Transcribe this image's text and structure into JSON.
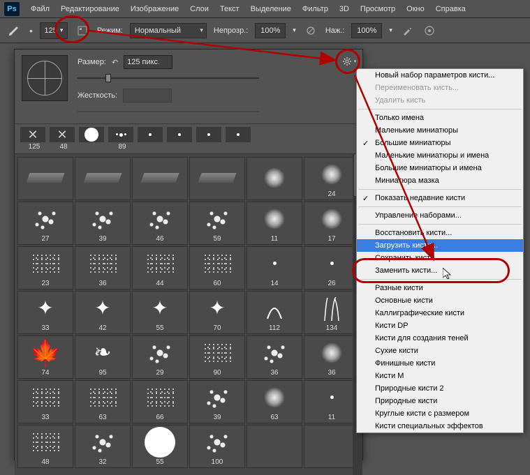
{
  "app": {
    "logo": "Ps"
  },
  "menu": [
    "Файл",
    "Редактирование",
    "Изображение",
    "Слои",
    "Текст",
    "Выделение",
    "Фильтр",
    "3D",
    "Просмотр",
    "Окно",
    "Справка"
  ],
  "options": {
    "brush_size": "125",
    "mode_label": "Режим:",
    "mode_value": "Нормальный",
    "opacity_label": "Непрозр.:",
    "opacity_value": "100%",
    "flow_label": "Наж.:",
    "flow_value": "100%"
  },
  "brush_panel": {
    "size_label": "Размер:",
    "size_value": "125 пикс.",
    "hardness_label": "Жесткость:",
    "strip": [
      {
        "n": "125",
        "t": "x"
      },
      {
        "n": "48",
        "t": "x"
      },
      {
        "n": "",
        "t": "big"
      },
      {
        "n": "89",
        "t": "dots"
      },
      {
        "n": "",
        "t": "dot"
      },
      {
        "n": "",
        "t": "dot"
      },
      {
        "n": "",
        "t": "dot"
      },
      {
        "n": "",
        "t": "dot"
      }
    ],
    "grid": [
      {
        "n": "",
        "t": "bar"
      },
      {
        "n": "",
        "t": "bar"
      },
      {
        "n": "",
        "t": "bar"
      },
      {
        "n": "",
        "t": "bar"
      },
      {
        "n": "",
        "t": "soft"
      },
      {
        "n": "24",
        "t": "soft"
      },
      {
        "n": "27",
        "t": "splat"
      },
      {
        "n": "39",
        "t": "splat"
      },
      {
        "n": "46",
        "t": "splat"
      },
      {
        "n": "59",
        "t": "splat"
      },
      {
        "n": "11",
        "t": "soft"
      },
      {
        "n": "17",
        "t": "soft"
      },
      {
        "n": "23",
        "t": "speck"
      },
      {
        "n": "36",
        "t": "speck"
      },
      {
        "n": "44",
        "t": "speck"
      },
      {
        "n": "60",
        "t": "speck"
      },
      {
        "n": "14",
        "t": "dot"
      },
      {
        "n": "26",
        "t": "dot"
      },
      {
        "n": "33",
        "t": "star"
      },
      {
        "n": "42",
        "t": "star"
      },
      {
        "n": "55",
        "t": "star"
      },
      {
        "n": "70",
        "t": "star"
      },
      {
        "n": "112",
        "t": "curve"
      },
      {
        "n": "134",
        "t": "grass"
      },
      {
        "n": "74",
        "t": "leaf"
      },
      {
        "n": "95",
        "t": "leaf2"
      },
      {
        "n": "29",
        "t": "splat"
      },
      {
        "n": "90",
        "t": "speck"
      },
      {
        "n": "36",
        "t": "splat"
      },
      {
        "n": "36",
        "t": "soft"
      },
      {
        "n": "33",
        "t": "speck"
      },
      {
        "n": "63",
        "t": "speck"
      },
      {
        "n": "66",
        "t": "speck"
      },
      {
        "n": "39",
        "t": "splat"
      },
      {
        "n": "63",
        "t": "soft"
      },
      {
        "n": "11",
        "t": "dot"
      },
      {
        "n": "48",
        "t": "speck"
      },
      {
        "n": "32",
        "t": "splat"
      },
      {
        "n": "55",
        "t": "big"
      },
      {
        "n": "100",
        "t": "splat"
      },
      {
        "n": "",
        "t": ""
      },
      {
        "n": "",
        "t": ""
      }
    ]
  },
  "gear_menu": {
    "s1": [
      "Новый набор параметров кисти..."
    ],
    "s1d": [
      "Переименовать кисть...",
      "Удалить кисть"
    ],
    "s2": [
      {
        "l": "Только имена",
        "c": false
      },
      {
        "l": "Маленькие миниатюры",
        "c": false
      },
      {
        "l": "Большие миниатюры",
        "c": true
      },
      {
        "l": "Маленькие миниатюры и имена",
        "c": false
      },
      {
        "l": "Большие миниатюры и имена",
        "c": false
      },
      {
        "l": "Миниатюра мазка",
        "c": false
      }
    ],
    "s3": [
      {
        "l": "Показать недавние кисти",
        "c": true
      }
    ],
    "s4": [
      "Управление наборами..."
    ],
    "s5": [
      "Восстановить кисти...",
      "Загрузить кисти...",
      "Сохранить кисти...",
      "Заменить кисти..."
    ],
    "s6": [
      "Разные кисти",
      "Основные кисти",
      "Каллиграфические кисти",
      "Кисти DP",
      "Кисти для создания теней",
      "Сухие кисти",
      "Финишные кисти",
      "Кисти М",
      "Природные кисти 2",
      "Природные кисти",
      "Круглые кисти с размером",
      "Кисти специальных эффектов"
    ]
  },
  "highlighted_item": "Загрузить кисти..."
}
